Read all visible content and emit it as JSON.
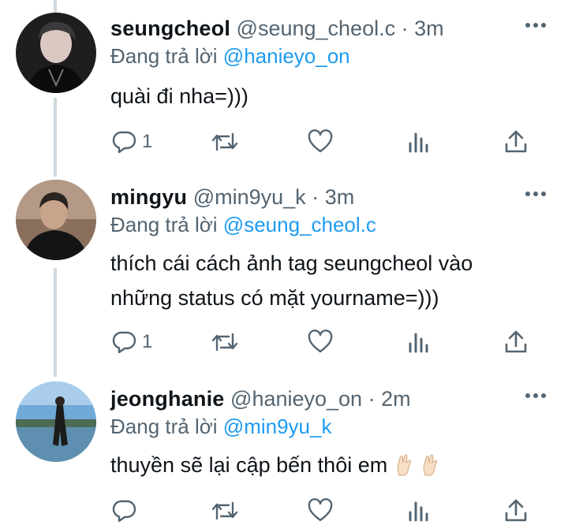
{
  "tweets": [
    {
      "name": "seungcheol",
      "handle": "@seung_cheol.c",
      "separator": "·",
      "time": "3m",
      "replying_prefix": "Đang trả lời",
      "replying_to": "@hanieyo_on",
      "text_lines": [
        "quài đi nha=)))"
      ],
      "reply_count": "1",
      "avatar_icon": "avatar-photo"
    },
    {
      "name": "mingyu",
      "handle": "@min9yu_k",
      "separator": "·",
      "time": "3m",
      "replying_prefix": "Đang trả lời",
      "replying_to": "@seung_cheol.c",
      "text_lines": [
        "thích cái cách ảnh tag seungcheol vào",
        "những status có mặt yourname=)))"
      ],
      "reply_count": "1",
      "avatar_icon": "avatar-photo"
    },
    {
      "name": "jeonghanie",
      "handle": "@hanieyo_on",
      "separator": "·",
      "time": "2m",
      "replying_prefix": "Đang trả lời",
      "replying_to": "@min9yu_k",
      "text_lines": [
        "thuyền sẽ lại cập bến thôi em"
      ],
      "text_emoji": "crossed-fingers-icon",
      "reply_count": "",
      "avatar_icon": "avatar-photo"
    }
  ],
  "icons": {
    "reply": "reply-icon",
    "retweet": "retweet-icon",
    "like": "heart-icon",
    "analytics": "analytics-icon",
    "share": "share-icon",
    "more": "more-dots-icon"
  },
  "colors": {
    "text": "#0f1419",
    "secondary": "#536471",
    "mention": "#1d9bf0",
    "thread_line": "#cfd9de"
  }
}
